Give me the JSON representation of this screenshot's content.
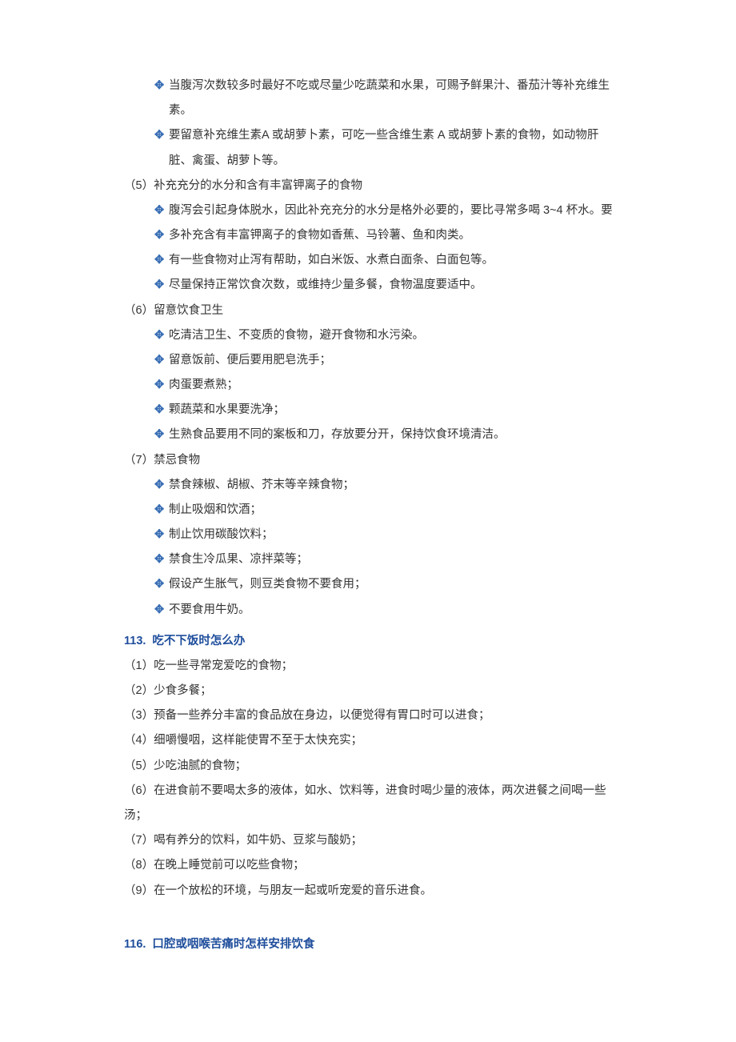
{
  "bullet_symbol": "✥",
  "top_bullets": [
    "当腹泻次数较多时最好不吃或尽量少吃蔬菜和水果，可赐予鲜果汁、番茄汁等补充维生素。",
    "要留意补充维生素A 或胡萝卜素，可吃一些含维生素 A 或胡萝卜素的食物，如动物肝脏、禽蛋、胡萝卜等。"
  ],
  "sections": [
    {
      "label": "（5）补充充分的水分和含有丰富钾离子的食物",
      "bullets": [
        "腹泻会引起身体脱水，因此补充充分的水分是格外必要的，要比寻常多喝 3~4 杯水。要",
        "多补充含有丰富钾离子的食物如香蕉、马铃薯、鱼和肉类。",
        "有一些食物对止泻有帮助，如白米饭、水煮白面条、白面包等。",
        "尽量保持正常饮食次数，或维持少量多餐，食物温度要适中。"
      ]
    },
    {
      "label": "（6）留意饮食卫生",
      "bullets": [
        "吃清洁卫生、不变质的食物，避开食物和水污染。",
        "留意饭前、便后要用肥皂洗手；",
        "肉蛋要煮熟；",
        "颗蔬菜和水果要洗净；",
        "生熟食品要用不同的案板和刀，存放要分开，保持饮食环境清洁。"
      ]
    },
    {
      "label": "（7）禁忌食物",
      "bullets": [
        "禁食辣椒、胡椒、芥末等辛辣食物；",
        "制止吸烟和饮酒；",
        "制止饮用碳酸饮料；",
        "禁食生冷瓜果、凉拌菜等；",
        "假设产生胀气，则豆类食物不要食用；",
        "不要食用牛奶。"
      ]
    }
  ],
  "heading113": {
    "num": "113.",
    "title": "吃不下饭时怎么办"
  },
  "ord_list": [
    "（1）吃一些寻常宠爱吃的食物；",
    "（2）少食多餐；",
    "（3）预备一些养分丰富的食品放在身边，以便觉得有胃口时可以进食；",
    "（4）细嚼慢咽，这样能使胃不至于太快充实；",
    "（5）少吃油腻的食物；",
    "（6）在进食前不要喝太多的液体，如水、饮料等，进食时喝少量的液体，两次进餐之间喝一些汤；",
    "（7）喝有养分的饮料，如牛奶、豆浆与酸奶；",
    "（8）在晚上睡觉前可以吃些食物；",
    "（9）在一个放松的环境，与朋友一起或听宠爱的音乐进食。"
  ],
  "heading116": {
    "num": "116.",
    "title": "口腔或咽喉苦痛时怎样安排饮食"
  }
}
